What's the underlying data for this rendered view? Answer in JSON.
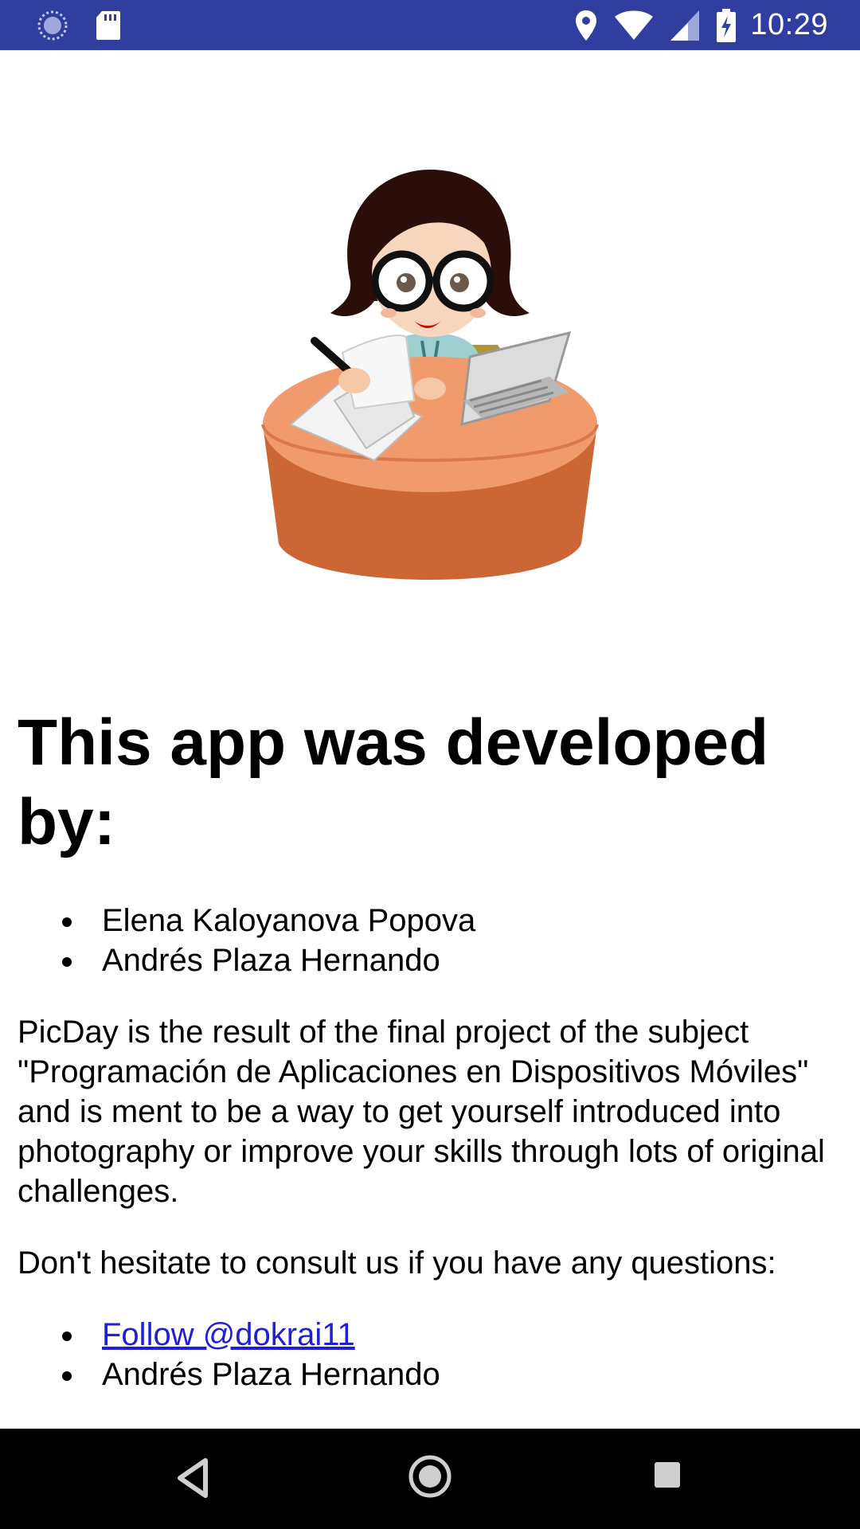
{
  "status_bar": {
    "time": "10:29",
    "left_icons": [
      "sync-icon",
      "sd-card-icon"
    ],
    "right_icons": [
      "location-icon",
      "wifi-icon",
      "signal-icon",
      "battery-charging-icon"
    ],
    "background": "#303f9f"
  },
  "about": {
    "heading": "This app was developed by:",
    "developers": [
      "Elena Kaloyanova Popova",
      "Andrés Plaza Hernando"
    ],
    "description": "PicDay is the result of the final project of the subject \"Programación de Aplicaciones en Dispositivos Móviles\" and is ment to be a way to get yourself introduced into photography or improve your skills through lots of original challenges.",
    "contact_prompt": "Don't hesitate to consult us if you have any questions:",
    "contacts": {
      "link_label": "Follow @dokrai11",
      "second": "Andrés Plaza Hernando"
    },
    "illustration": "developer-at-desk-illustration"
  },
  "nav_bar": {
    "buttons": [
      "back-icon",
      "home-icon",
      "recents-icon"
    ]
  }
}
